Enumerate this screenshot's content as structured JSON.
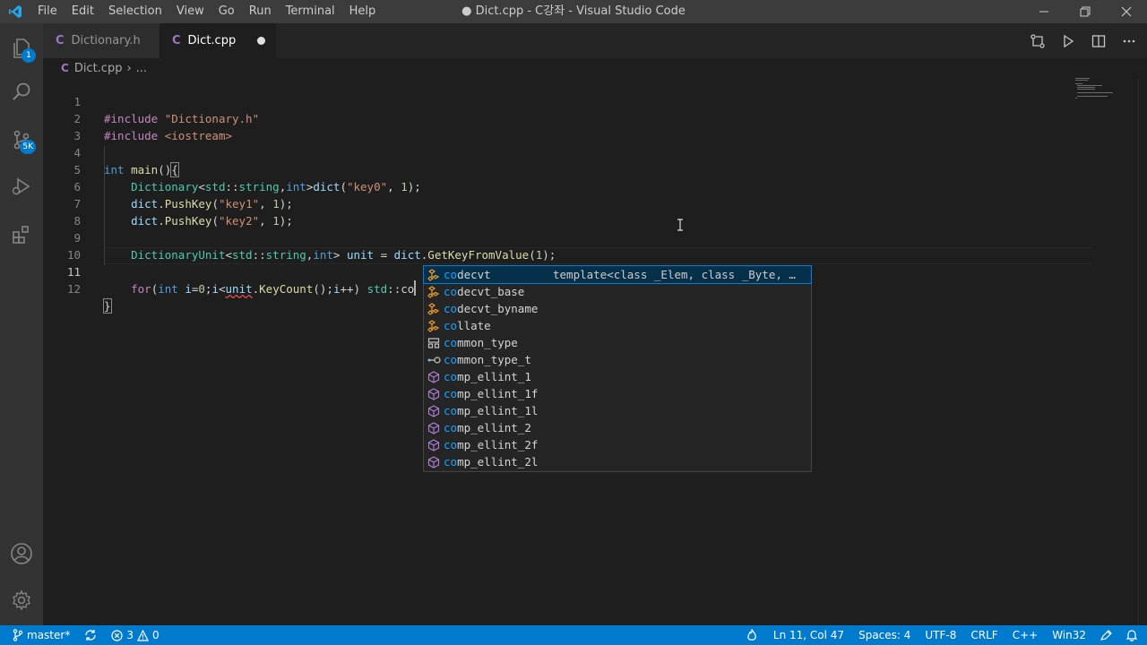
{
  "window": {
    "title": "● Dict.cpp - C강좌 - Visual Studio Code",
    "menu": [
      "File",
      "Edit",
      "Selection",
      "View",
      "Go",
      "Run",
      "Terminal",
      "Help"
    ]
  },
  "activity_bar": {
    "explorer_badge": "1",
    "scm_badge": "5K"
  },
  "tabs": [
    {
      "label": "Dictionary.h",
      "icon": "C"
    },
    {
      "label": "Dict.cpp",
      "icon": "C",
      "modified": true
    }
  ],
  "breadcrumb": {
    "icon": "C",
    "file": "Dict.cpp",
    "sep": "›",
    "rest": "..."
  },
  "editor": {
    "line_numbers": [
      "1",
      "2",
      "3",
      "4",
      "5",
      "6",
      "7",
      "8",
      "9",
      "10",
      "11",
      "12"
    ],
    "current_line": "11",
    "lines": {
      "l1": {
        "a": "#include",
        "b": " ",
        "c": "\"Dictionary.h\""
      },
      "l2": {
        "a": "#include",
        "b": " ",
        "c": "<iostream>"
      },
      "l4": {
        "a": "int",
        "b": " ",
        "c": "main",
        "d": "()",
        "e": "{"
      },
      "l5": {
        "indent": "    ",
        "a": "Dictionary",
        "b": "<",
        "c": "std",
        "d": "::",
        "e": "string",
        "f": ",",
        "g": "int",
        "h": ">",
        "i": "dict",
        "j": "(",
        "k": "\"key0\"",
        "l": ", ",
        "m": "1",
        "n": ");"
      },
      "l6": {
        "indent": "    ",
        "a": "dict",
        "b": ".",
        "c": "PushKey",
        "d": "(",
        "e": "\"key1\"",
        "f": ", ",
        "g": "1",
        "h": ");"
      },
      "l7": {
        "indent": "    ",
        "a": "dict",
        "b": ".",
        "c": "PushKey",
        "d": "(",
        "e": "\"key2\"",
        "f": ", ",
        "g": "1",
        "h": ");"
      },
      "l9": {
        "indent": "    ",
        "a": "DictionaryUnit",
        "b": "<",
        "c": "std",
        "d": "::",
        "e": "string",
        "f": ",",
        "g": "int",
        "h": ">",
        "i": " ",
        "j": "unit",
        "k": " = ",
        "l": "dict",
        "m": ".",
        "n": "GetKeyFromValue",
        "o": "(",
        "p": "1",
        "q": ");"
      },
      "l11": {
        "indent": "    ",
        "a": "for",
        "b": "(",
        "c": "int",
        "d": " ",
        "e": "i",
        "f": "=",
        "g": "0",
        "h": ";",
        "i": "i",
        "j": "<",
        "k": "unit",
        "l": ".",
        "m": "KeyCount",
        "n": "();",
        "o": "i",
        "p": "++) ",
        "q": "std",
        "r": "::",
        "s": "co"
      },
      "l12": {
        "a": "}"
      }
    }
  },
  "suggest": {
    "items": [
      {
        "match": "co",
        "rest": "decvt",
        "detail": "template<class _Elem, class _Byte, …",
        "kind": "class"
      },
      {
        "match": "co",
        "rest": "decvt_base",
        "kind": "class"
      },
      {
        "match": "co",
        "rest": "decvt_byname",
        "kind": "class"
      },
      {
        "match": "co",
        "rest": "llate",
        "kind": "class"
      },
      {
        "match": "co",
        "rest": "mmon_type",
        "kind": "struct"
      },
      {
        "match": "co",
        "rest": "mmon_type_t",
        "kind": "typedef"
      },
      {
        "match": "co",
        "rest": "mp_ellint_1",
        "kind": "method"
      },
      {
        "match": "co",
        "rest": "mp_ellint_1f",
        "kind": "method"
      },
      {
        "match": "co",
        "rest": "mp_ellint_1l",
        "kind": "method"
      },
      {
        "match": "co",
        "rest": "mp_ellint_2",
        "kind": "method"
      },
      {
        "match": "co",
        "rest": "mp_ellint_2f",
        "kind": "method"
      },
      {
        "match": "co",
        "rest": "mp_ellint_2l",
        "kind": "method"
      }
    ]
  },
  "status": {
    "branch": "master*",
    "errors": "3",
    "warnings": "0",
    "position": "Ln 11, Col 47",
    "spaces": "Spaces: 4",
    "encoding": "UTF-8",
    "eol": "CRLF",
    "language": "C++",
    "config": "Win32"
  },
  "colors": {
    "accent": "#007acc",
    "title_bar": "#3c3c3c",
    "activity_bar": "#333333",
    "editor_bg": "#1e1e1e"
  }
}
